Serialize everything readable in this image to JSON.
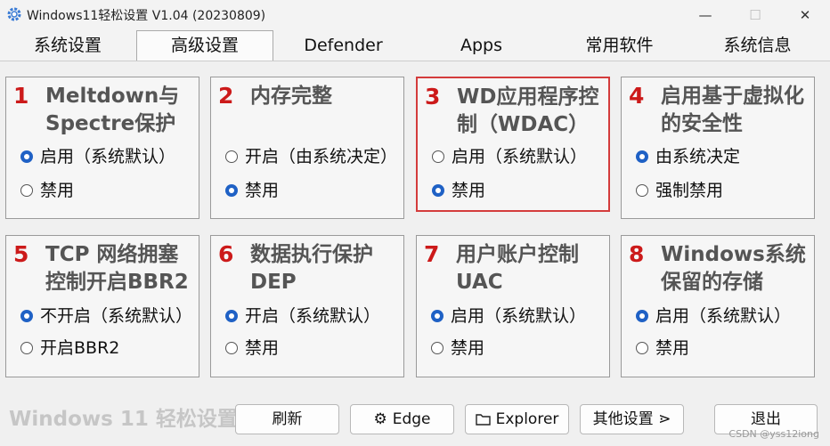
{
  "window": {
    "title": "Windows11轻松设置 V1.04 (20230809)",
    "min_symbol": "—",
    "max_symbol": "☐",
    "close_symbol": "✕"
  },
  "tabs": [
    {
      "label": "系统设置",
      "active": false
    },
    {
      "label": "高级设置",
      "active": true
    },
    {
      "label": "Defender",
      "active": false
    },
    {
      "label": "Apps",
      "active": false
    },
    {
      "label": "常用软件",
      "active": false
    },
    {
      "label": "系统信息",
      "active": false
    }
  ],
  "cards": [
    {
      "num": "1",
      "title": "Meltdown与Spectre保护",
      "options": [
        {
          "label": "启用（系统默认）",
          "selected": true
        },
        {
          "label": "禁用",
          "selected": false
        }
      ]
    },
    {
      "num": "2",
      "title": "内存完整",
      "options": [
        {
          "label": "开启（由系统决定）",
          "selected": false
        },
        {
          "label": "禁用",
          "selected": true
        }
      ]
    },
    {
      "num": "3",
      "title": "WD应用程序控制（WDAC）",
      "options": [
        {
          "label": "启用（系统默认）",
          "selected": false
        },
        {
          "label": "禁用",
          "selected": true
        }
      ]
    },
    {
      "num": "4",
      "title": "启用基于虚拟化的安全性",
      "options": [
        {
          "label": "由系统决定",
          "selected": true
        },
        {
          "label": "强制禁用",
          "selected": false
        }
      ]
    },
    {
      "num": "5",
      "title": "TCP 网络拥塞控制开启BBR2",
      "options": [
        {
          "label": "不开启（系统默认）",
          "selected": true
        },
        {
          "label": "开启BBR2",
          "selected": false
        }
      ]
    },
    {
      "num": "6",
      "title": "数据执行保护DEP",
      "options": [
        {
          "label": "开启（系统默认）",
          "selected": true
        },
        {
          "label": "禁用",
          "selected": false
        }
      ]
    },
    {
      "num": "7",
      "title": "用户账户控制UAC",
      "options": [
        {
          "label": "启用（系统默认）",
          "selected": true
        },
        {
          "label": "禁用",
          "selected": false
        }
      ]
    },
    {
      "num": "8",
      "title": "Windows系统保留的存储",
      "options": [
        {
          "label": "启用（系统默认）",
          "selected": true
        },
        {
          "label": "禁用",
          "selected": false
        }
      ]
    }
  ],
  "footer": {
    "brand": "Windows 11 轻松设置",
    "buttons": {
      "refresh": "刷新",
      "edge": "Edge",
      "explorer": "Explorer",
      "other": "其他设置 ⋗",
      "exit": "退出"
    },
    "watermark": "CSDN @yss12iong"
  },
  "colors": {
    "accent": "#1f61c5",
    "number_red": "#cc1a1a",
    "highlight_border": "#d43c3c"
  }
}
